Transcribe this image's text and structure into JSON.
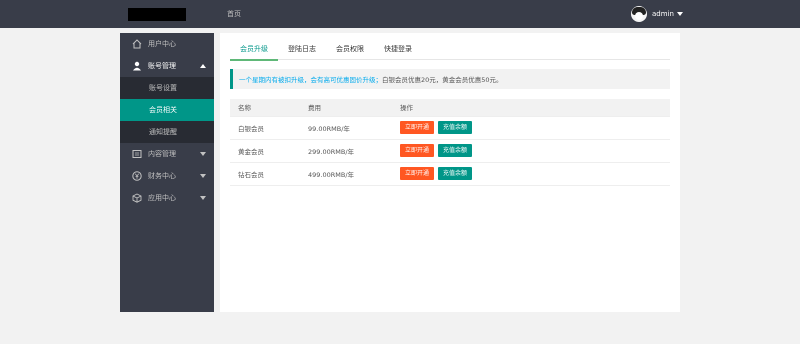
{
  "topbar": {
    "home_label": "首页",
    "username": "admin"
  },
  "sidebar": {
    "items": [
      {
        "label": "用户中心",
        "icon": "home-icon"
      },
      {
        "label": "账号管理",
        "icon": "user-icon",
        "open": true,
        "children": [
          {
            "label": "账号设置"
          },
          {
            "label": "会员相关",
            "active": true
          },
          {
            "label": "通知提醒"
          }
        ]
      },
      {
        "label": "内容管理",
        "icon": "list-icon"
      },
      {
        "label": "财务中心",
        "icon": "yen-icon"
      },
      {
        "label": "应用中心",
        "icon": "cube-icon"
      }
    ]
  },
  "main": {
    "tabs": [
      "会员升级",
      "登陆日志",
      "会员权限",
      "快捷登录"
    ],
    "notice": {
      "link_text": "一个星期内有被扣升级，会有高可优惠固价升级；",
      "rest_text": "白银会员优惠20元，黄金会员优惠50元。"
    },
    "table": {
      "headers": [
        "名称",
        "费用",
        "操作"
      ],
      "rows": [
        {
          "name": "白银会员",
          "fee": "99.00RMB/年"
        },
        {
          "name": "黄金会员",
          "fee": "299.00RMB/年"
        },
        {
          "name": "钻石会员",
          "fee": "499.00RMB/年"
        }
      ],
      "open_label": "立即开通",
      "charge_label": "充值余额"
    }
  },
  "colors": {
    "topbar_bg": "#393d49",
    "accent": "#009688",
    "danger": "#ff5722"
  }
}
